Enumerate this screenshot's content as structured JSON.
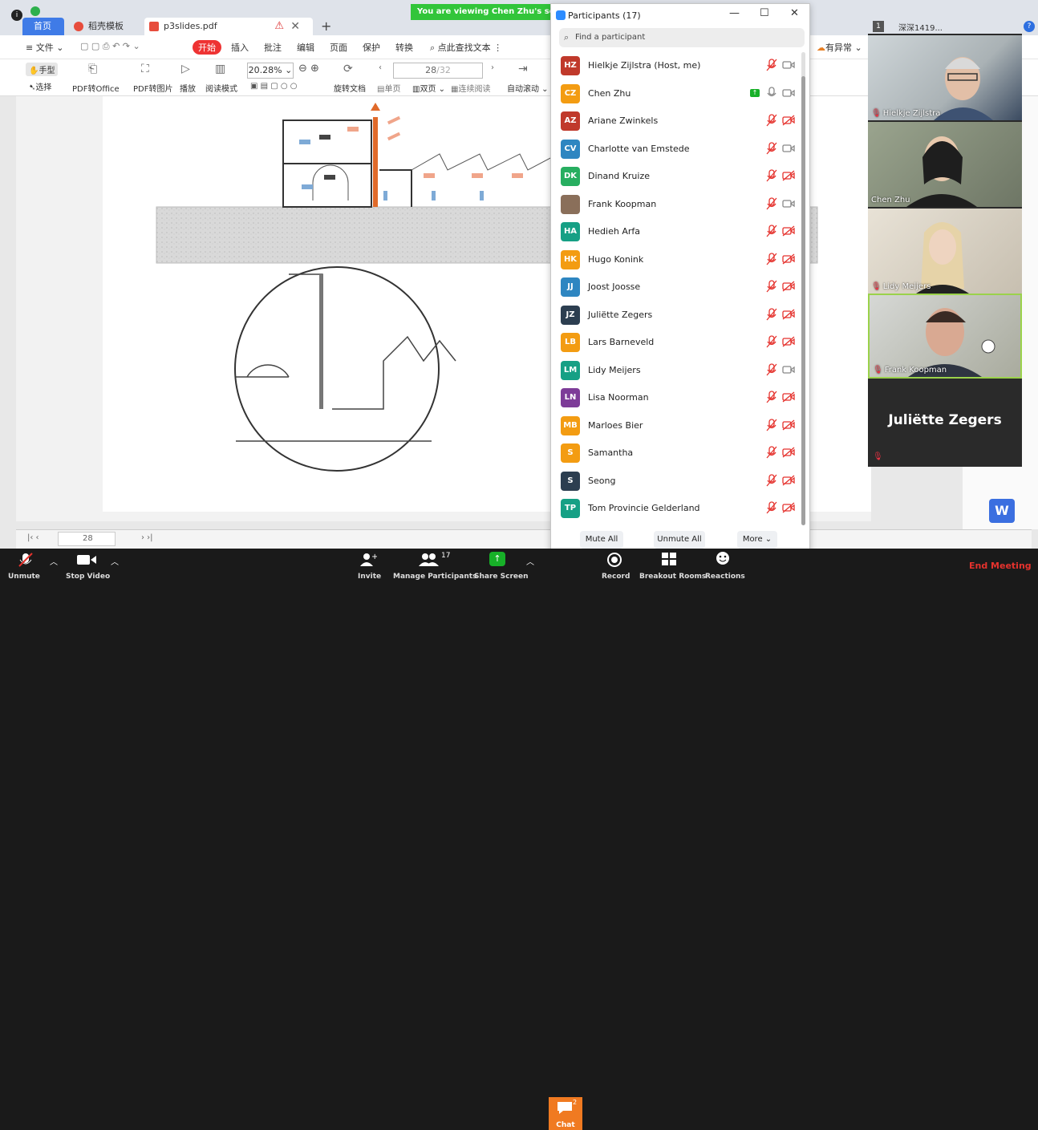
{
  "banner": {
    "text": "You are viewing Chen Zhu's screen"
  },
  "wps": {
    "tabs": {
      "home": "首页",
      "templates": "稻壳模板",
      "document": "p3slides.pdf"
    },
    "menu": [
      "文件",
      "开始",
      "插入",
      "批注",
      "编辑",
      "页面",
      "保护",
      "转换",
      "点此查找文本"
    ],
    "ribbon": {
      "hand": "手型",
      "select": "选择",
      "pdf_office": "PDF转Office",
      "pdf_image": "PDF转图片",
      "play": "播放",
      "read_mode": "阅读模式",
      "zoom": "20.28%",
      "rotate": "旋转文档",
      "page_current": "28",
      "page_total": "/32",
      "single": "单页",
      "double": "双页",
      "continuous": "连续阅读",
      "auto_scroll": "自动滚动"
    },
    "right_tools": {
      "abnormal": "有异常",
      "deep": "深深1419..."
    },
    "footer": {
      "page": "28"
    }
  },
  "participants": {
    "title": "Participants (17)",
    "search_placeholder": "Find a participant",
    "items": [
      {
        "initials": "HZ",
        "name": "Hielkje Zijlstra (Host, me)",
        "color": "#c0392b"
      },
      {
        "initials": "CZ",
        "name": "Chen Zhu",
        "color": "#f39c12"
      },
      {
        "initials": "AZ",
        "name": "Ariane Zwinkels",
        "color": "#c0392b"
      },
      {
        "initials": "CV",
        "name": "Charlotte van Emstede",
        "color": "#2e86c1"
      },
      {
        "initials": "DK",
        "name": "Dinand Kruize",
        "color": "#27ae60"
      },
      {
        "initials": "",
        "name": "Frank Koopman",
        "color": "#8a6f5a"
      },
      {
        "initials": "HA",
        "name": "Hedieh Arfa",
        "color": "#16a085"
      },
      {
        "initials": "HK",
        "name": "Hugo Konink",
        "color": "#f39c12"
      },
      {
        "initials": "JJ",
        "name": "Joost Joosse",
        "color": "#2e86c1"
      },
      {
        "initials": "JZ",
        "name": "Juliëtte Zegers",
        "color": "#2c3e50"
      },
      {
        "initials": "LB",
        "name": "Lars Barneveld",
        "color": "#f39c12"
      },
      {
        "initials": "LM",
        "name": "Lidy Meijers",
        "color": "#16a085"
      },
      {
        "initials": "LN",
        "name": "Lisa Noorman",
        "color": "#7d3c98"
      },
      {
        "initials": "MB",
        "name": "Marloes Bier",
        "color": "#f39c12"
      },
      {
        "initials": "S",
        "name": "Samantha",
        "color": "#f39c12"
      },
      {
        "initials": "S",
        "name": "Seong",
        "color": "#2c3e50"
      },
      {
        "initials": "TP",
        "name": "Tom Provincie Gelderland",
        "color": "#16a085"
      }
    ],
    "mute_all": "Mute All",
    "unmute_all": "Unmute All",
    "more": "More"
  },
  "videos": [
    {
      "name": "Hielkje Zijlstra"
    },
    {
      "name": "Chen Zhu"
    },
    {
      "name": "Lidy Meijers"
    },
    {
      "name": "Frank Koopman"
    }
  ],
  "big_name": "Juliëtte Zegers",
  "toolbar": {
    "unmute": "Unmute",
    "stop_video": "Stop Video",
    "invite": "Invite",
    "manage_participants": "Manage Participants",
    "participant_count": "17",
    "share_screen": "Share Screen",
    "chat": "Chat",
    "chat_badge": "2",
    "record": "Record",
    "breakout_rooms": "Breakout Rooms",
    "reactions": "Reactions",
    "end_meeting": "End Meeting"
  }
}
